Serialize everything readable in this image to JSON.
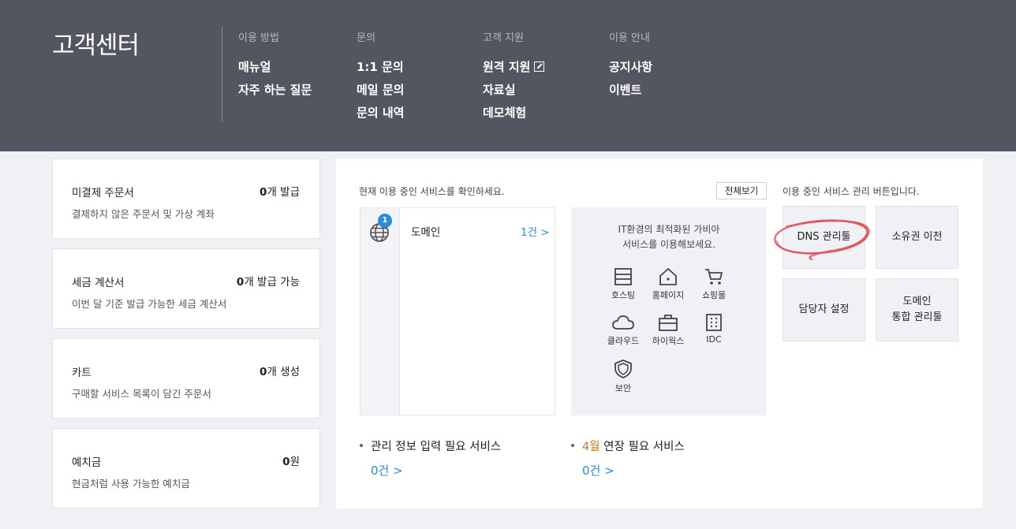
{
  "header": {
    "title": "고객센터",
    "columns": [
      {
        "heading": "이용 방법",
        "links": [
          "매뉴얼",
          "자주 하는 질문"
        ]
      },
      {
        "heading": "문의",
        "links": [
          "1:1 문의",
          "메일 문의",
          "문의 내역"
        ]
      },
      {
        "heading": "고객 지원",
        "links": [
          "원격 지원",
          "자료실",
          "데모체험"
        ]
      },
      {
        "heading": "이용 안내",
        "links": [
          "공지사항",
          "이벤트"
        ]
      }
    ]
  },
  "cards": [
    {
      "title": "미결제 주문서",
      "value": "0",
      "unit": "개 발급",
      "desc": "결제하지 않은 주문서 및 가상 계좌"
    },
    {
      "title": "세금 계산서",
      "value": "0",
      "unit": "개 발급 가능",
      "desc": "이번 달 기준 발급 가능한 세금 계산서"
    },
    {
      "title": "카트",
      "value": "0",
      "unit": "개 생성",
      "desc": "구매할 서비스 목록이 담긴 주문서"
    },
    {
      "title": "예치금",
      "value": "0",
      "unit": "원",
      "desc": "현금처럼 사용 가능한 예치금"
    }
  ],
  "main": {
    "intro": "현재 이용 중인 서비스를 확인하세요.",
    "view_all": "전체보기",
    "service": {
      "badge": "1",
      "name": "도메인",
      "count": "1건 >"
    },
    "promo": {
      "line1": "IT환경의 최적화된 가비아",
      "line2": "서비스를 이용해보세요.",
      "items": [
        {
          "label": "호스팅",
          "icon": "hosting-icon"
        },
        {
          "label": "홈페이지",
          "icon": "homepage-icon"
        },
        {
          "label": "쇼핑몰",
          "icon": "cart-icon"
        },
        {
          "label": "클라우드",
          "icon": "cloud-icon"
        },
        {
          "label": "하이웍스",
          "icon": "briefcase-icon"
        },
        {
          "label": "IDC",
          "icon": "building-icon"
        },
        {
          "label": "보안",
          "icon": "shield-icon"
        }
      ]
    },
    "management": {
      "intro": "이용 중인 서비스 관리 버튼입니다.",
      "buttons": [
        {
          "line1": "DNS 관리툴",
          "line2": ""
        },
        {
          "line1": "소유권 이전",
          "line2": ""
        },
        {
          "line1": "담당자 설정",
          "line2": ""
        },
        {
          "line1": "도메인",
          "line2": "통합 관리툴"
        }
      ],
      "annotation_color": "#d9434a"
    },
    "bottom": {
      "info_title": "관리 정보 입력 필요 서비스",
      "info_count": "0건 >",
      "renew_month": "4월",
      "renew_title": " 연장 필요 서비스",
      "renew_count": "0건 >"
    }
  },
  "colors": {
    "header_bg": "#535561",
    "accent": "#2d8bd4",
    "month": "#c17a13"
  }
}
